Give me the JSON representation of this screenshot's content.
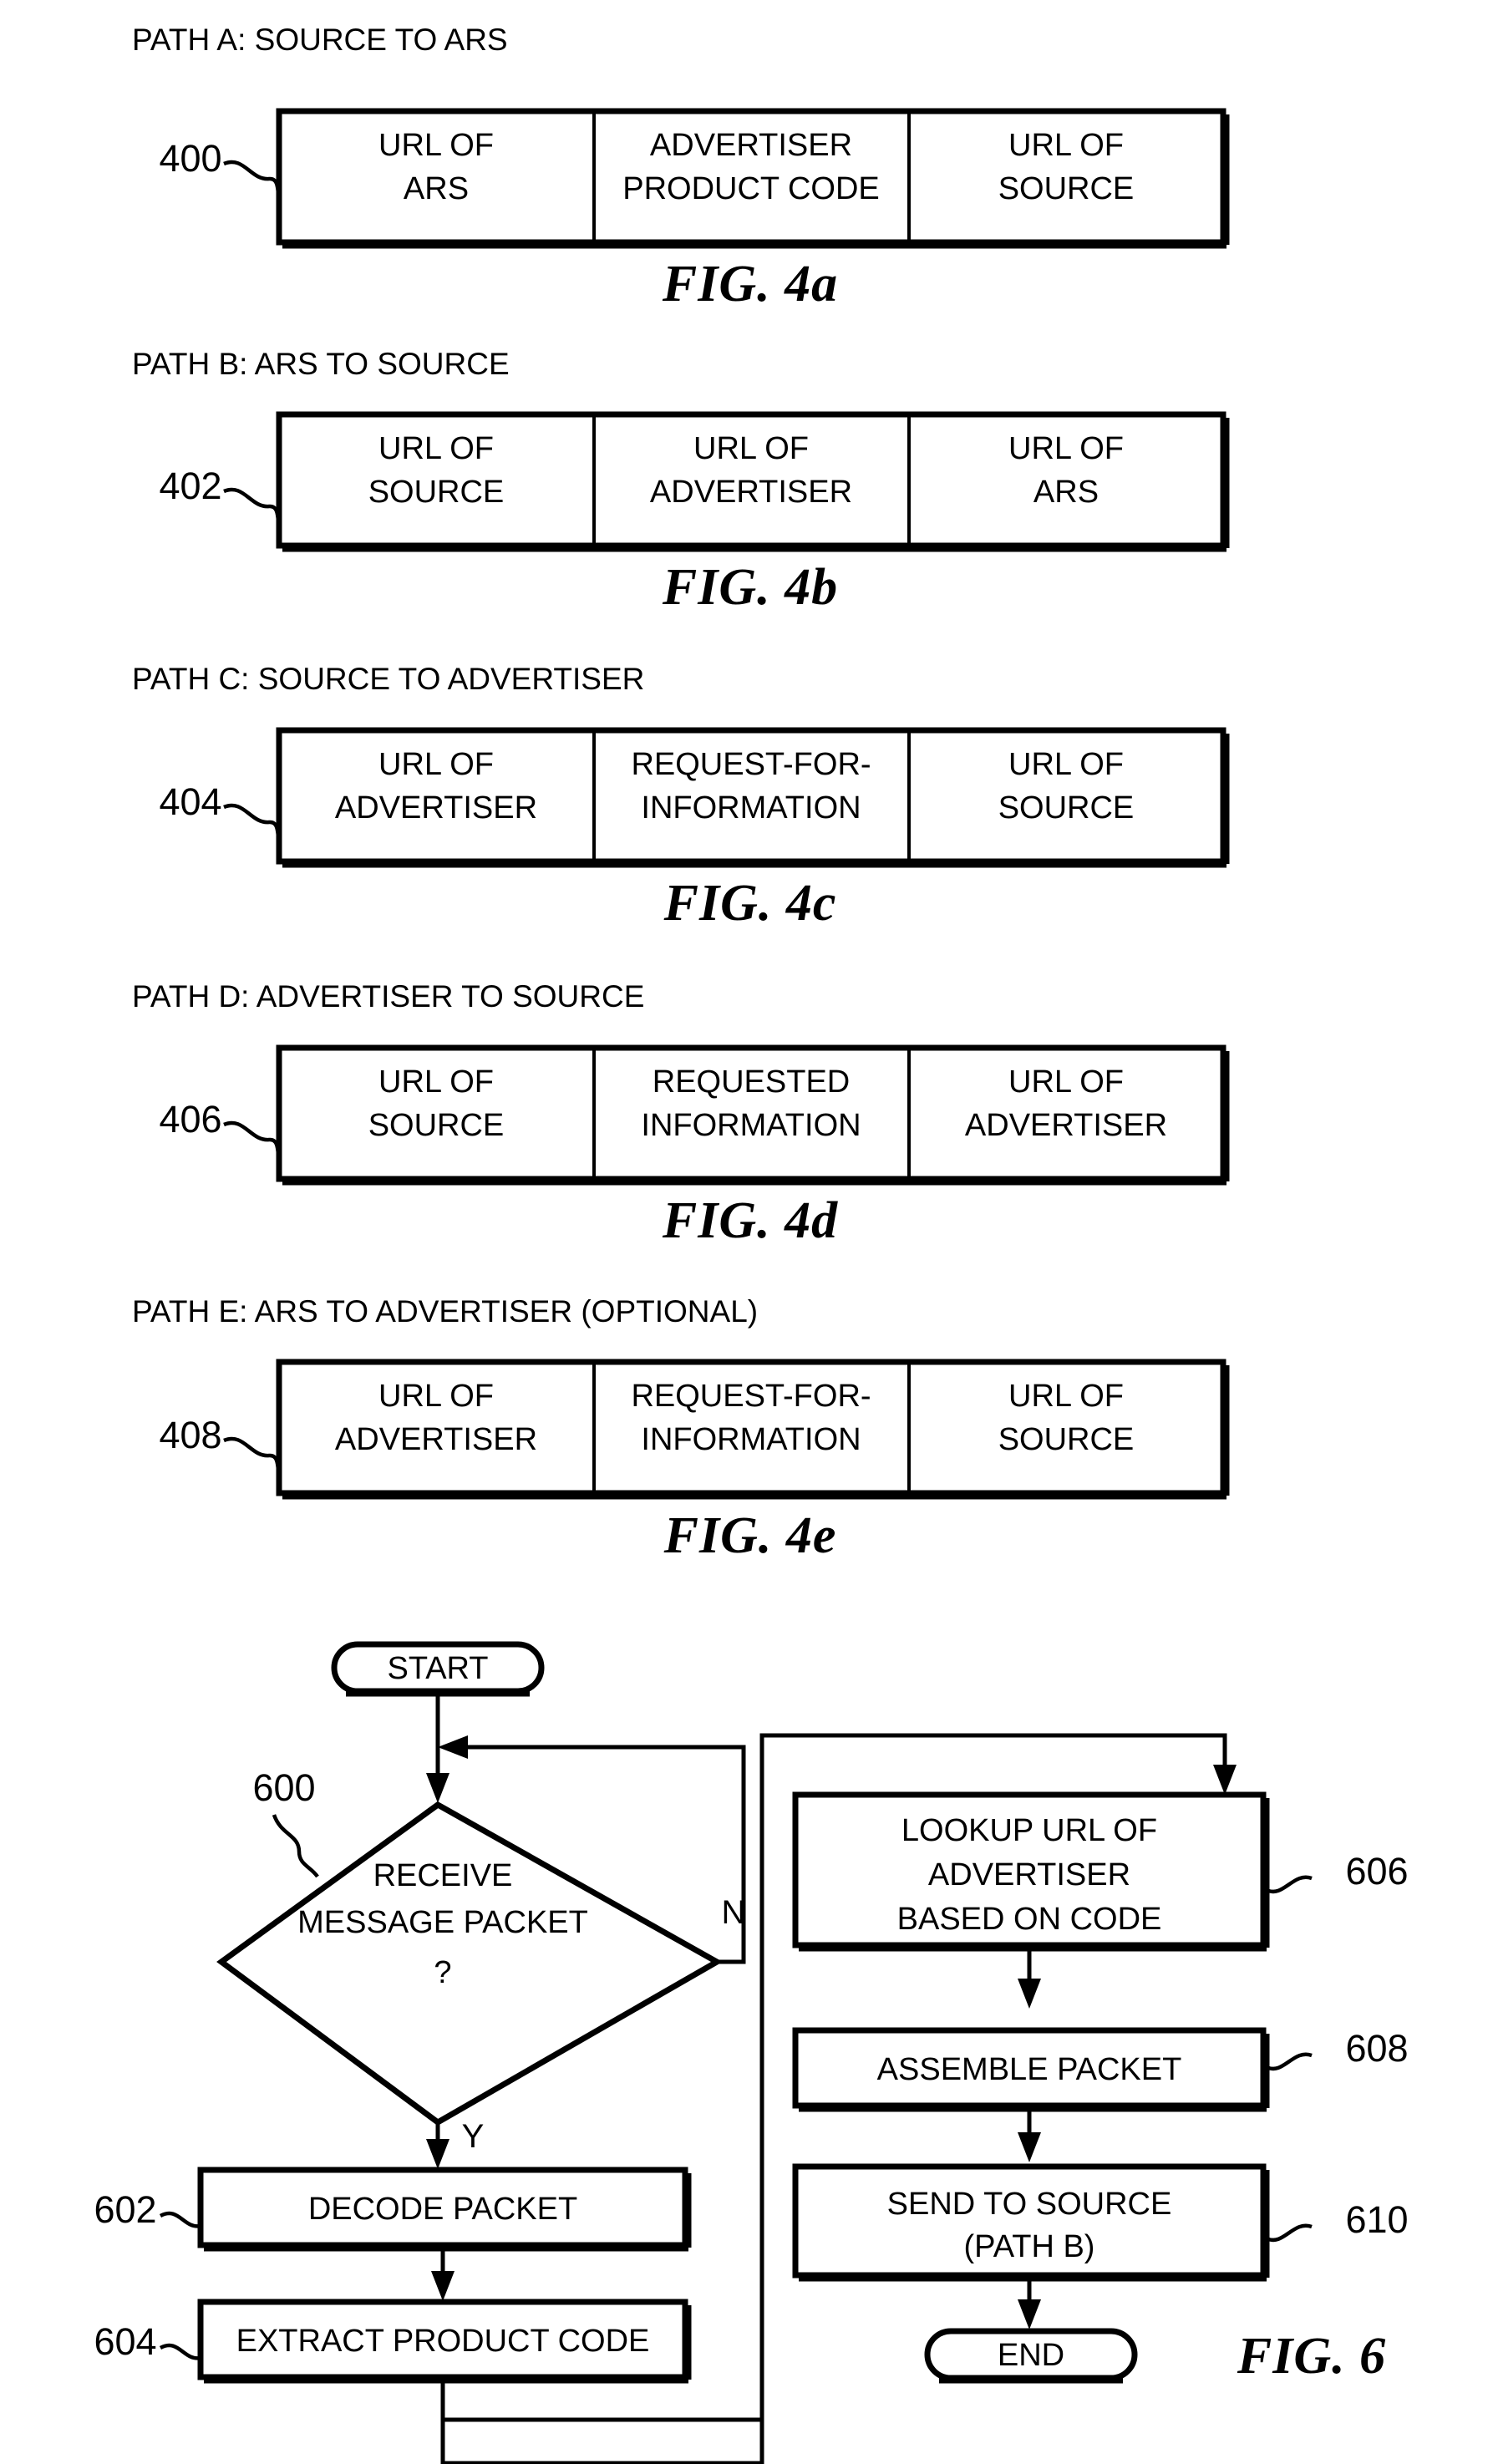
{
  "document": {
    "kind": "patent-drawing-sheet",
    "figures": [
      {
        "id": "fig-4a",
        "caption": "FIG. 4a",
        "heading": "PATH A: SOURCE TO ARS",
        "ref": "400",
        "cells": [
          "URL OF\nARS",
          "ADVERTISER\nPRODUCT CODE",
          "URL OF\nSOURCE"
        ],
        "cell_lines": [
          [
            "URL OF",
            "ARS"
          ],
          [
            "ADVERTISER",
            "PRODUCT CODE"
          ],
          [
            "URL OF",
            "SOURCE"
          ]
        ]
      },
      {
        "id": "fig-4b",
        "caption": "FIG. 4b",
        "heading": "PATH B: ARS TO SOURCE",
        "ref": "402",
        "cell_lines": [
          [
            "URL OF",
            "SOURCE"
          ],
          [
            "URL OF",
            "ADVERTISER"
          ],
          [
            "URL OF",
            "ARS"
          ]
        ]
      },
      {
        "id": "fig-4c",
        "caption": "FIG. 4c",
        "heading": "PATH C: SOURCE TO ADVERTISER",
        "ref": "404",
        "cell_lines": [
          [
            "URL OF",
            "ADVERTISER"
          ],
          [
            "REQUEST-FOR-",
            "INFORMATION"
          ],
          [
            "URL OF",
            "SOURCE"
          ]
        ]
      },
      {
        "id": "fig-4d",
        "caption": "FIG. 4d",
        "heading": "PATH D: ADVERTISER TO SOURCE",
        "ref": "406",
        "cell_lines": [
          [
            "URL OF",
            "SOURCE"
          ],
          [
            "REQUESTED",
            "INFORMATION"
          ],
          [
            "URL OF",
            "ADVERTISER"
          ]
        ]
      },
      {
        "id": "fig-4e",
        "caption": "FIG. 4e",
        "heading": "PATH E: ARS TO ADVERTISER (OPTIONAL)",
        "ref": "408",
        "cell_lines": [
          [
            "URL OF",
            "ADVERTISER"
          ],
          [
            "REQUEST-FOR-",
            "INFORMATION"
          ],
          [
            "URL OF",
            "SOURCE"
          ]
        ]
      }
    ],
    "flowchart": {
      "caption": "FIG. 6",
      "start_label": "START",
      "end_label": "END",
      "decision": {
        "ref": "600",
        "lines": [
          "RECEIVE",
          "MESSAGE PACKET",
          "?"
        ],
        "yes_label": "Y",
        "no_label": "N"
      },
      "steps": [
        {
          "ref": "602",
          "lines": [
            "DECODE PACKET"
          ]
        },
        {
          "ref": "604",
          "lines": [
            "EXTRACT PRODUCT CODE"
          ]
        },
        {
          "ref": "606",
          "lines": [
            "LOOKUP URL OF",
            "ADVERTISER",
            "BASED ON CODE"
          ]
        },
        {
          "ref": "608",
          "lines": [
            "ASSEMBLE PACKET"
          ]
        },
        {
          "ref": "610",
          "lines": [
            "SEND TO SOURCE",
            "(PATH B)"
          ]
        }
      ]
    },
    "colors": {
      "ink": "#000000",
      "paper": "#ffffff"
    }
  }
}
